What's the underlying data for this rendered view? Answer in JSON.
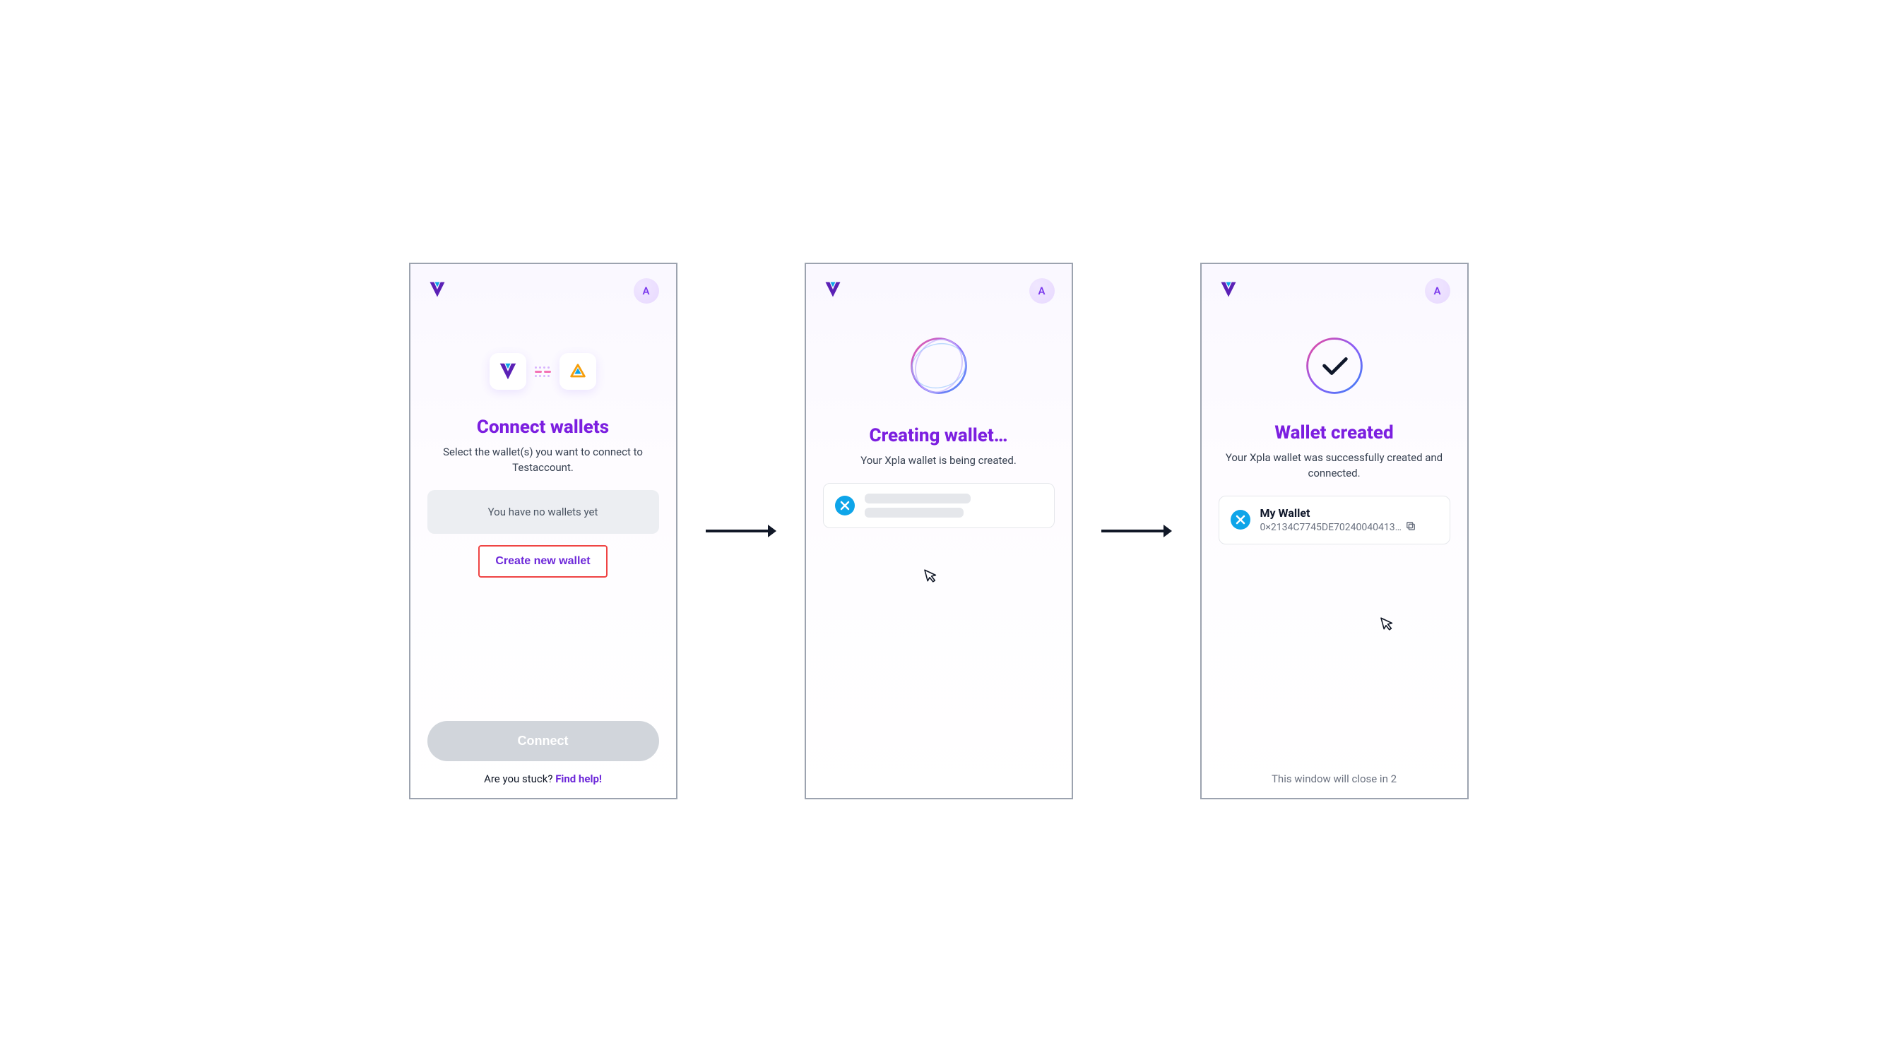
{
  "avatar_letter": "A",
  "panel1": {
    "title": "Connect wallets",
    "subtitle": "Select the wallet(s) you want to connect to Testaccount.",
    "empty": "You have no wallets yet",
    "create": "Create new wallet",
    "cta": "Connect",
    "stuck": "Are you stuck? ",
    "help": "Find help!"
  },
  "panel2": {
    "title": "Creating wallet…",
    "subtitle": "Your Xpla wallet is being created."
  },
  "panel3": {
    "title": "Wallet created",
    "subtitle": "Your Xpla wallet was successfully created and connected.",
    "wallet_name": "My Wallet",
    "wallet_addr": "0×2134C7745DE70240040413…",
    "closing": "This window will close in 2"
  }
}
